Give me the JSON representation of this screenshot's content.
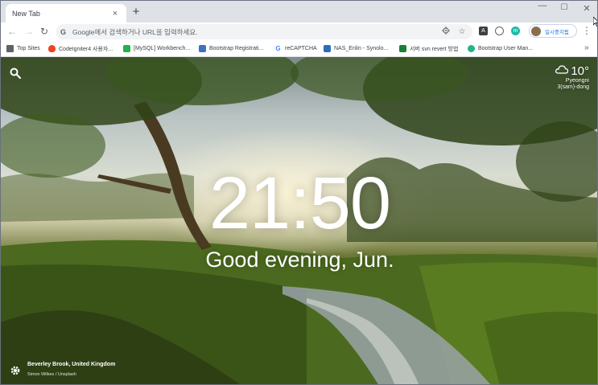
{
  "browser": {
    "tab": {
      "title": "New Tab",
      "close": "×"
    },
    "new_tab": "+",
    "window_controls": {
      "minimize": "—",
      "maximize": "☐",
      "close": "✕"
    },
    "nav": {
      "back": "←",
      "forward": "→",
      "reload": "↻"
    },
    "omnibox": {
      "g": "G",
      "placeholder": "Google에서 검색하거나 URL을 입력하세요."
    },
    "extensions": [
      {
        "label": "A",
        "color": "#3c4043"
      },
      {
        "label": "◎",
        "color": "#5f6368"
      },
      {
        "label": "m",
        "color": "#1fb8a8"
      }
    ],
    "profile": {
      "label": "일시중지됨"
    },
    "menu": "⋮"
  },
  "bookmarks": {
    "items": [
      {
        "label": "Top Sites",
        "icon": "folder-icon",
        "color": "#5f6368",
        "glyph": ""
      },
      {
        "label": "CodeIgniter4 사용자...",
        "icon": "flame-icon",
        "color": "#ee4323",
        "glyph": ""
      },
      {
        "label": "[MySQL] Workbench...",
        "icon": "chat-icon",
        "color": "#22b14c",
        "glyph": ""
      },
      {
        "label": "Bootstrap Registrati...",
        "icon": "code-icon",
        "color": "#3b73c4",
        "glyph": ""
      },
      {
        "label": "reCAPTCHA",
        "icon": "google-icon",
        "color": "#ffffff",
        "glyph": "G"
      },
      {
        "label": "NAS_Enlin - Synolo...",
        "icon": "synology-icon",
        "color": "#2a6ebb",
        "glyph": ""
      },
      {
        "label": "서버 svn revert 방법",
        "icon": "book-icon",
        "color": "#1a7f37",
        "glyph": ""
      },
      {
        "label": "Bootstrap User Man...",
        "icon": "shield-icon",
        "color": "#21b589",
        "glyph": ""
      }
    ],
    "more": "»"
  },
  "momentum": {
    "time": "21:50",
    "greeting": "Good evening, Jun.",
    "weather": {
      "temp": "10°",
      "location_line1": "Pyeongni",
      "location_line2": "3(sam)-dong"
    },
    "photo": {
      "location": "Beverley Brook, United Kingdom",
      "credit": "Simon Wilkes / Unsplash"
    }
  }
}
